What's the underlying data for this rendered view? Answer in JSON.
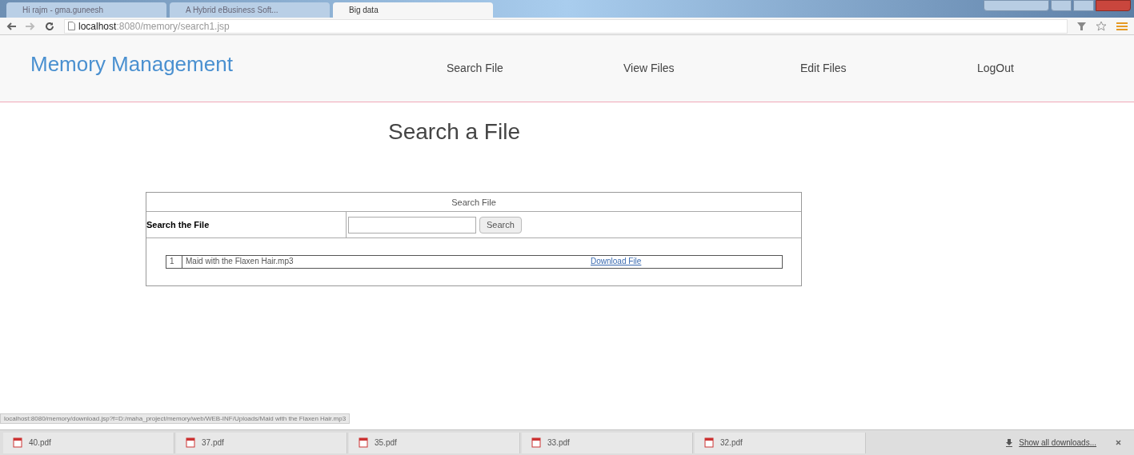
{
  "browser": {
    "tabs": [
      {
        "title": "Hi rajm - gma.guneesh",
        "selected": false
      },
      {
        "title": "A Hybrid eBusiness Soft...",
        "selected": false
      },
      {
        "title": "Big data",
        "selected": true
      }
    ],
    "address": {
      "host": "localhost",
      "rest": ":8080/memory/search1.jsp"
    }
  },
  "navbar": {
    "brand": "Memory Management",
    "links": [
      "Search File",
      "View Files",
      "Edit Files",
      "LogOut"
    ]
  },
  "heading": "Search a File",
  "form": {
    "caption": "Search File",
    "label": "Search the File",
    "button": "Search",
    "results": [
      {
        "index": "1",
        "name": "Maid with the Flaxen Hair.mp3",
        "link": "Download File"
      }
    ]
  },
  "status_url": "localhost:8080/memory/download.jsp?f=D:/maha_project/memory/web/WEB-INF/Uploads/Maid with the Flaxen Hair.mp3",
  "downloads": {
    "files": [
      "40.pdf",
      "37.pdf",
      "35.pdf",
      "33.pdf",
      "32.pdf"
    ],
    "show_all": "Show all downloads..."
  }
}
